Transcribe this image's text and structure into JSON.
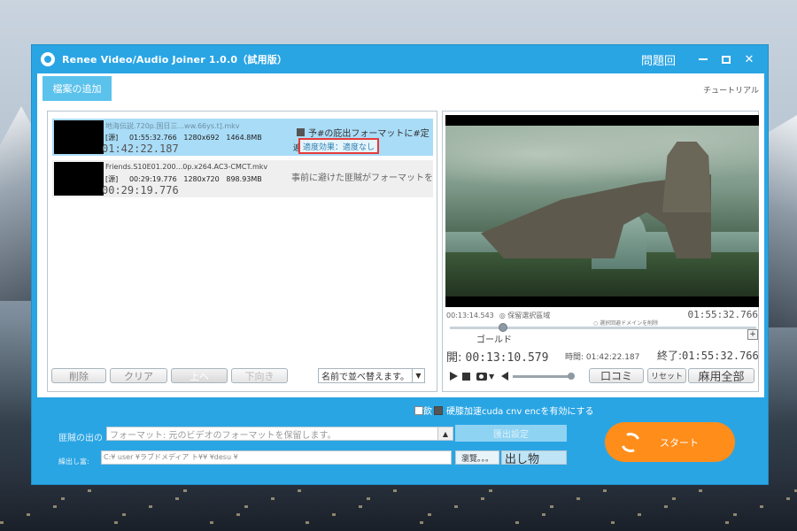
{
  "window": {
    "title": "Renee Video/Audio Joiner 1.0.0（試用版）",
    "help": "問題回",
    "close": "✕"
  },
  "toolbar": {
    "add_file": "檔案の追加",
    "tutorial": "チュートリアル"
  },
  "files": [
    {
      "name": "地海伝説.720p.国日三...ww.66ys.t].mkv",
      "tag": "[源]",
      "length": "01:55:32.766",
      "resolution": "1280x692",
      "size": "1464.8MB",
      "duration_display": "01:42:22.187",
      "checkbox_label": "予#の庇出フォーマットに#定",
      "fx_label": "遍",
      "fx_text": "適度効果：適度なし"
    },
    {
      "name": "Friends.S10E01.200...0p.x264.AC3-CMCT.mkv",
      "tag": "[源]",
      "length": "00:29:19.776",
      "resolution": "1280x720",
      "size": "898.93MB",
      "duration_display": "00:29:19.776",
      "note": "事前に避けた匪賊がフォーマットを出すことにしました"
    }
  ],
  "list_buttons": {
    "delete": "削除",
    "clear": "クリア",
    "up": "上へ",
    "down": "下向き",
    "sort": "名前で並べ替えます。",
    "sort_arrow": "▼"
  },
  "preview": {
    "current_time": "00:13:14.543",
    "mode_label": "保留選択區域",
    "total_time": "01:55:32.766",
    "small_note": "選択回避ドメインを削除",
    "gold_label": "ゴールド",
    "open_label": "開:",
    "open_time": "00:13:10.579",
    "length_label": "時間:",
    "length_time": "01:42:22.187",
    "end_label": "終了:",
    "end_time": "01:55:32.766",
    "btn_speech": "口コミ",
    "btn_reset": "リセット",
    "btn_apply_all": "麻用全部",
    "end_marker": "+",
    "caret": "▼"
  },
  "bottom": {
    "hw_prefix": "飲",
    "hw_label": "硬膝加速cuda cnv encを有効にする",
    "output_label": "匪賊の出の",
    "output_value": "フォーマット: 元のビデオのフォーマットを保留します。",
    "output_arrow": "▲",
    "output_settings": "匯出設定",
    "dest_label": "繰出し富:",
    "dest_value": "C:¥ user   ¥ラブドメディア ト¥¥ ¥desu ¥",
    "browse": "瀏覽。。。",
    "open": "出し物",
    "start": "スタート"
  },
  "colors": {
    "accent": "#2aa5e4",
    "selected_row": "#a9dcf7",
    "start": "#ff8d1a",
    "highlight_box": "#e63a3a"
  }
}
